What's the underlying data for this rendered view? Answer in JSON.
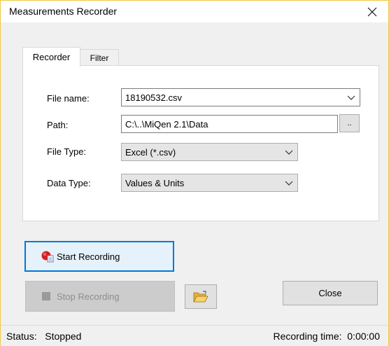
{
  "window": {
    "title": "Measurements Recorder"
  },
  "tabs": [
    {
      "label": "Recorder",
      "active": true
    },
    {
      "label": "Filter",
      "active": false
    }
  ],
  "form": {
    "file_name": {
      "label": "File name:",
      "value": "18190532.csv"
    },
    "path": {
      "label": "Path:",
      "value": "C:\\..\\MiQen 2.1\\Data",
      "browse_label": ".."
    },
    "file_type": {
      "label": "File Type:",
      "value": "Excel (*.csv)"
    },
    "data_type": {
      "label": "Data Type:",
      "value": "Values & Units"
    }
  },
  "buttons": {
    "start_recording": "Start Recording",
    "stop_recording": "Stop Recording",
    "close": "Close"
  },
  "status": {
    "label": "Status:",
    "value": "Stopped",
    "recording_time_label": "Recording time:",
    "recording_time_value": "0:00:00"
  },
  "icons": {
    "start": "record-icon",
    "stop": "stop-icon",
    "folder": "folder-open-icon",
    "chevron": "chevron-down-icon",
    "close": "close-icon"
  },
  "colors": {
    "window_border": "#f1c644",
    "focus_blue": "#0078d7",
    "record_red": "#d62020"
  }
}
